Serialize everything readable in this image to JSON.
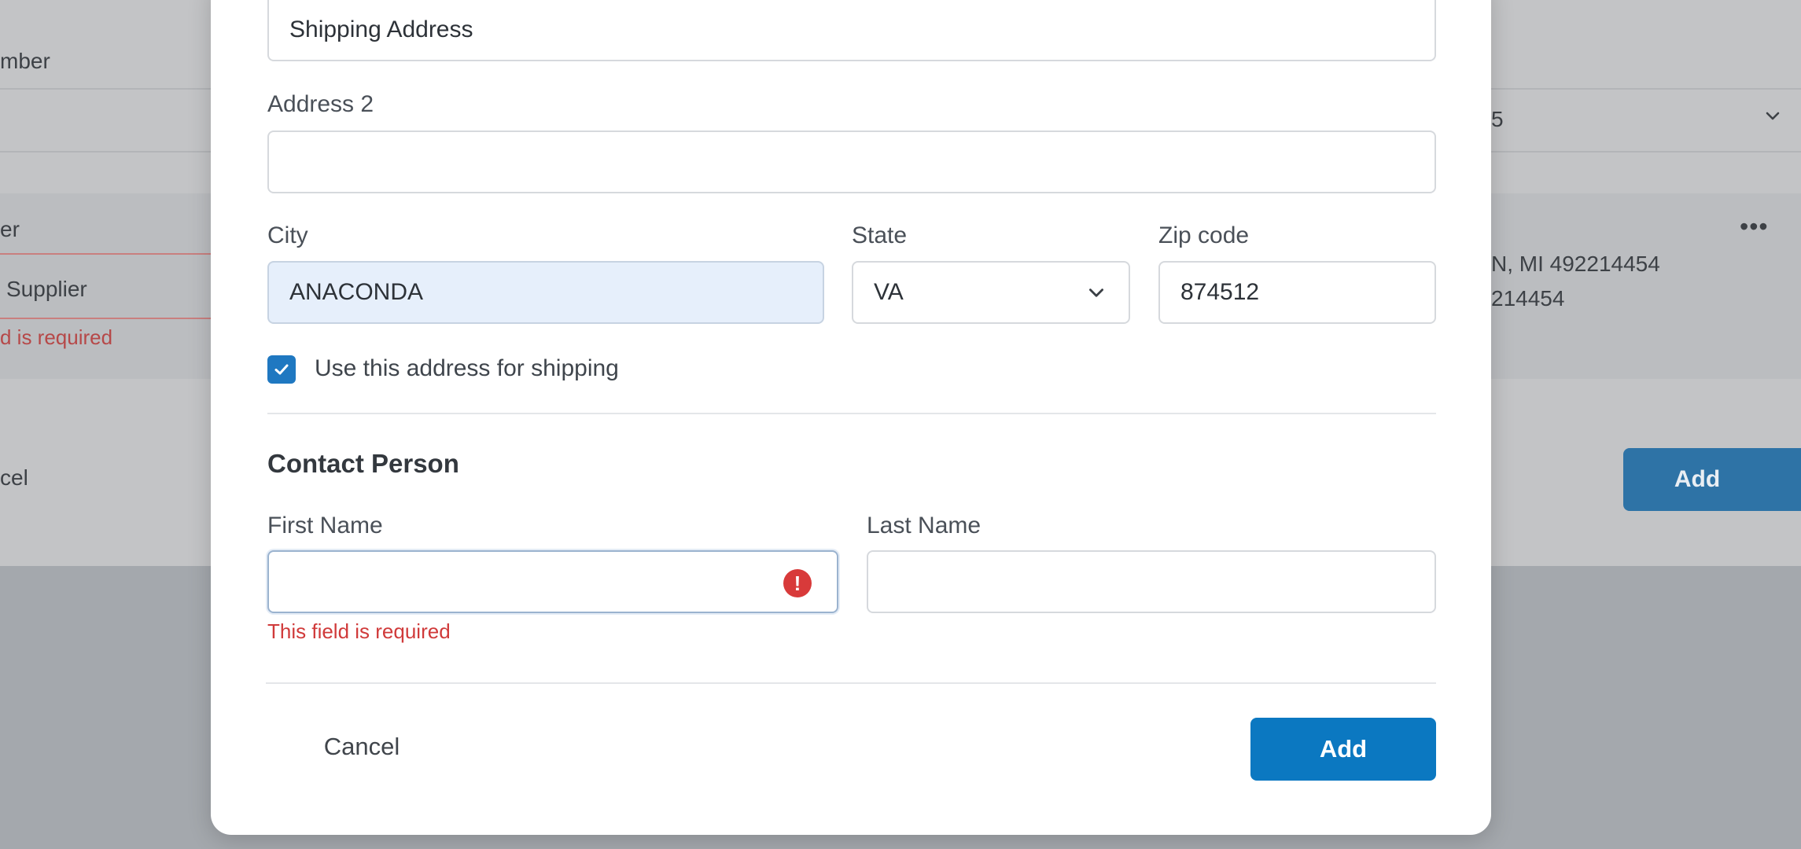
{
  "background": {
    "field_label_partial": "mber",
    "dropdown_value_partial": "5",
    "name_label_partial": "er",
    "supplier_partial": "Supplier",
    "error_partial": "d is required",
    "address_line1_partial": "N, MI 492214454",
    "address_line2_partial": "214454",
    "more_label": "•••",
    "cancel_partial": "cel",
    "add_label": "Add"
  },
  "modal": {
    "address1": {
      "value": "Shipping Address"
    },
    "address2": {
      "label": "Address 2",
      "value": ""
    },
    "city": {
      "label": "City",
      "value": "ANACONDA"
    },
    "state": {
      "label": "State",
      "value": "VA"
    },
    "zip": {
      "label": "Zip code",
      "value": "874512"
    },
    "use_for_shipping": {
      "label": "Use this address for shipping",
      "checked": true
    },
    "contact_section_title": "Contact Person",
    "first_name": {
      "label": "First Name",
      "value": "",
      "error": "This field is required",
      "error_icon": "!"
    },
    "last_name": {
      "label": "Last Name",
      "value": ""
    },
    "cancel_label": "Cancel",
    "add_label": "Add"
  },
  "colors": {
    "primary": "#0b78c1",
    "error": "#d03a3a",
    "filled_field": "#e6effb"
  }
}
